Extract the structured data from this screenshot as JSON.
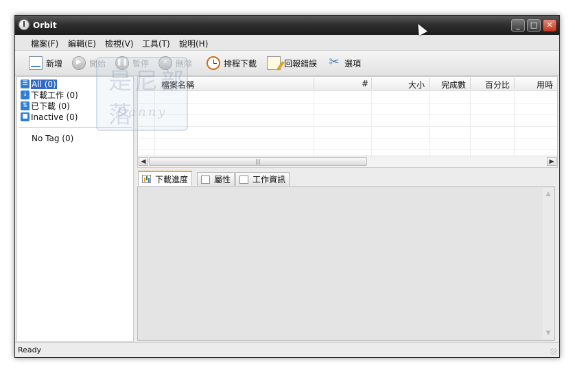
{
  "window": {
    "title": "Orbit"
  },
  "menu": [
    "檔案(F)",
    "編輯(E)",
    "檢視(V)",
    "工具(T)",
    "說明(H)"
  ],
  "toolbar": {
    "new": "新增",
    "start": "開始",
    "pause": "暫停",
    "delete": "刪除",
    "schedule": "排程下載",
    "report": "回報錯誤",
    "options": "選項"
  },
  "sidebar": {
    "items": [
      {
        "label": "All (0)",
        "icon": "list-icon",
        "selected": true
      },
      {
        "label": "下載工作 (0)",
        "icon": "download-icon",
        "selected": false
      },
      {
        "label": "已下載 (0)",
        "icon": "completed-icon",
        "selected": false
      },
      {
        "label": "Inactive (0)",
        "icon": "inactive-icon",
        "selected": false
      }
    ],
    "tag": "No Tag (0)"
  },
  "watermark": {
    "big": "是尼部落",
    "small": "Danny"
  },
  "file_list": {
    "columns": [
      "檔案名稱",
      "#",
      "大小",
      "完成數",
      "百分比",
      "用時"
    ],
    "rows": []
  },
  "tabs": [
    "下載進度",
    "屬性",
    "工作資訊"
  ],
  "status": {
    "text": "Ready"
  },
  "colors": {
    "titlebar": "#2f2f2f",
    "selection": "#3169c6",
    "tab_accent": "#f0a820"
  }
}
